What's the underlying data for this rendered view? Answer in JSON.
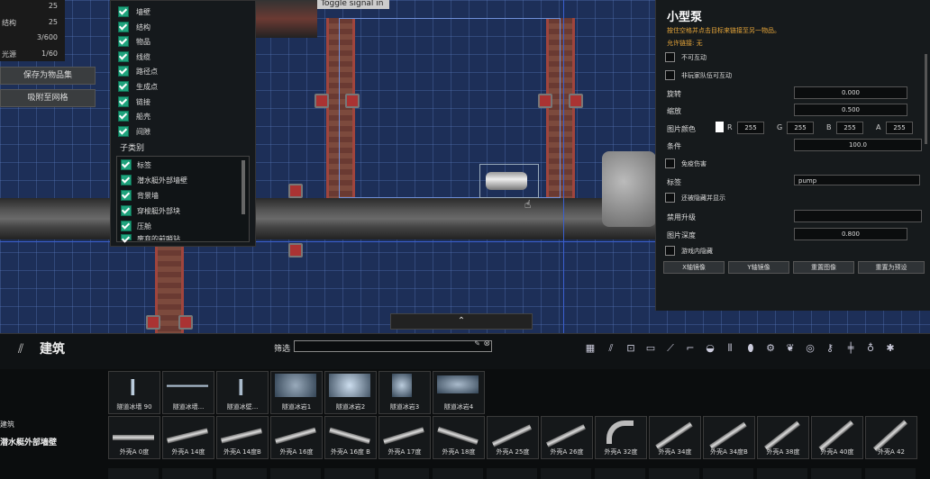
{
  "stats": [
    {
      "label": "",
      "value": "25"
    },
    {
      "label": "结构",
      "value": "25"
    },
    {
      "label": "",
      "value": "3/600"
    },
    {
      "label": "光源",
      "value": "1/60"
    }
  ],
  "left_buttons": {
    "save": "保存为物品集",
    "snap": "吸附至网格"
  },
  "categories": [
    "墙壁",
    "结构",
    "物品",
    "线缆",
    "路径点",
    "生成点",
    "链接",
    "船壳",
    "间隙"
  ],
  "subcategory_title": "子类别",
  "subcategories": [
    "标签",
    "潜水艇外部墙壁",
    "背景墙",
    "穿梭艇外部块",
    "压舱",
    "废弃的前哨站"
  ],
  "canvas_tag": "Toggle signal in",
  "props": {
    "title": "小型泵",
    "description": "按住空格并点击目标来链接至另一物品。",
    "link_allowed": "允许链接: 无",
    "checkbox_interact": "不可互动",
    "checkbox_player_damage": "非玩家队伍可互动",
    "rotation_label": "旋转",
    "rotation_value": "0.000",
    "scale_label": "缩放",
    "scale_value": "0.500",
    "sprite_color_label": "图片颜色",
    "r_label": "R",
    "r_value": "255",
    "g_label": "G",
    "g_value": "255",
    "b_label": "B",
    "b_value": "255",
    "a_label": "A",
    "a_value": "255",
    "condition_label": "条件",
    "condition_value": "100.0",
    "checkbox_invulnerable": "免疫伤害",
    "tags_label": "标签",
    "tags_value": "pump",
    "checkbox_hidden": "还被隐藏并显示",
    "upgrade_label": "禁用升级",
    "upgrade_value": "",
    "depth_label": "图片深度",
    "depth_value": "0.800",
    "checkbox_ingame": "游戏内隐藏",
    "btn_mirror_x": "X轴镜像",
    "btn_mirror_y": "Y轴镜像",
    "btn_reset_sprite": "重置图像",
    "btn_reset_default": "重置为预设"
  },
  "build": {
    "title": "建筑",
    "filter_label": "筛选",
    "filter_value": ""
  },
  "side_labels": {
    "category": "建筑",
    "subcategory": "潜水艇外部墙壁"
  },
  "row1_tiles": [
    "隧道冰墙 90",
    "隧道冰墙...",
    "隧道冰壁...",
    "隧道冰岩1",
    "隧道冰岩2",
    "隧道冰岩3",
    "隧道冰岩4"
  ],
  "row2_tiles": [
    "外壳A 0度",
    "外壳A 14度",
    "外壳A 14度B",
    "外壳A 16度",
    "外壳A 16度 B",
    "外壳A 17度",
    "外壳A 18度",
    "外壳A 25度",
    "外壳A 26度",
    "外壳A 32度",
    "外壳A 34度",
    "外壳A 34度B",
    "外壳A 38度",
    "外壳A 40度",
    "外壳A 42"
  ],
  "colors": {
    "accent": "#1fa37d",
    "warning": "#e8a73a",
    "grid": "#1d2f58"
  }
}
